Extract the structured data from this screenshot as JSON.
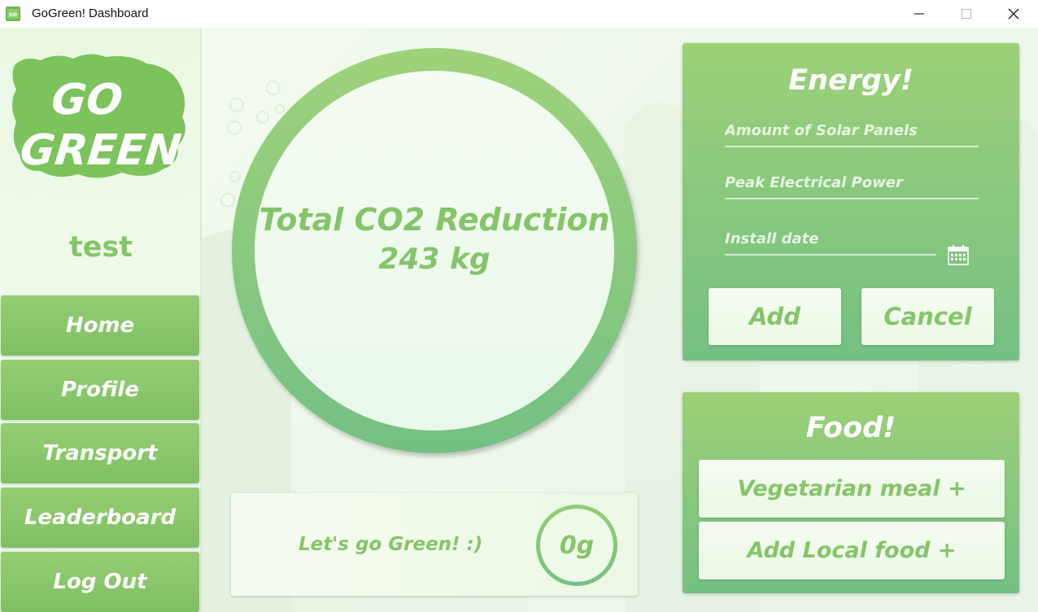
{
  "window": {
    "title": "GoGreen! Dashboard",
    "controls": {
      "minimize": "minimize",
      "maximize": "maximize",
      "close": "close"
    }
  },
  "colors": {
    "accent": "#86c46a",
    "panel_top": "#9dd077",
    "panel_bottom": "#74c084",
    "button_text": "#ffffff"
  },
  "sidebar": {
    "logo_text": "GO GREEN",
    "username": "test",
    "nav": [
      {
        "label": "Home"
      },
      {
        "label": "Profile"
      },
      {
        "label": "Transport"
      },
      {
        "label": "Leaderboard"
      },
      {
        "label": "Log Out"
      }
    ]
  },
  "main": {
    "co2": {
      "title": "Total CO2 Reduction",
      "value": "243 kg"
    },
    "message": {
      "text": "Let's go Green! :)",
      "badge": "0g"
    }
  },
  "energy": {
    "title": "Energy!",
    "fields": {
      "solar_panels": {
        "placeholder": "Amount of Solar Panels",
        "value": ""
      },
      "peak_power": {
        "placeholder": "Peak Electrical Power",
        "value": ""
      },
      "install_date": {
        "placeholder": "Install date",
        "value": ""
      }
    },
    "add_label": "Add",
    "cancel_label": "Cancel",
    "calendar_icon": "calendar-icon"
  },
  "food": {
    "title": "Food!",
    "vegetarian_label": "Vegetarian meal +",
    "local_label": "Add Local food +"
  }
}
